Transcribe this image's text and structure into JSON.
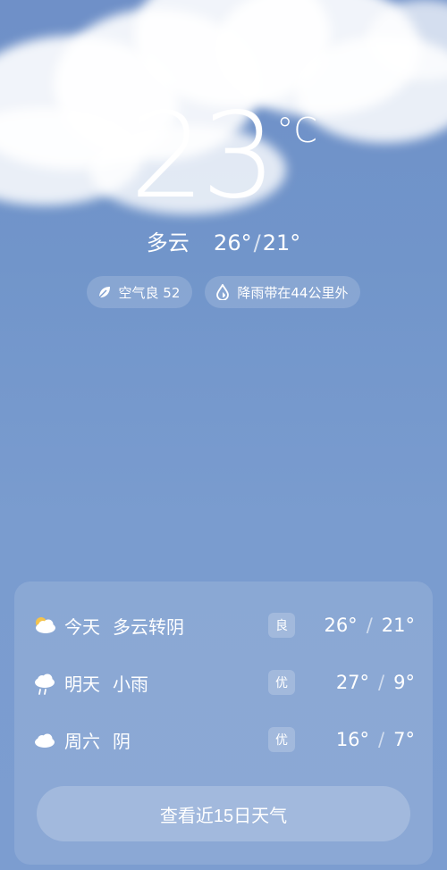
{
  "current": {
    "temperature": "23",
    "unit": "°C",
    "condition": "多云",
    "high": "26°",
    "low": "21°"
  },
  "chips": {
    "air_quality": "空气良 52",
    "rain": "降雨带在44公里外"
  },
  "forecast": [
    {
      "day": "今天",
      "desc": "多云转阴",
      "aq": "良",
      "high": "26°",
      "low": "21°",
      "icon": "cloudy-sun-icon"
    },
    {
      "day": "明天",
      "desc": "小雨",
      "aq": "优",
      "high": "27°",
      "low": "9°",
      "icon": "light-rain-icon"
    },
    {
      "day": "周六",
      "desc": "阴",
      "aq": "优",
      "high": "16°",
      "low": "7°",
      "icon": "overcast-icon"
    }
  ],
  "forecast_button": "查看近15日天气",
  "colors": {
    "sky_top": "#6f90c8",
    "sky_bottom": "#7c9dd0",
    "text": "#ffffff",
    "sun": "#f4c34c"
  }
}
